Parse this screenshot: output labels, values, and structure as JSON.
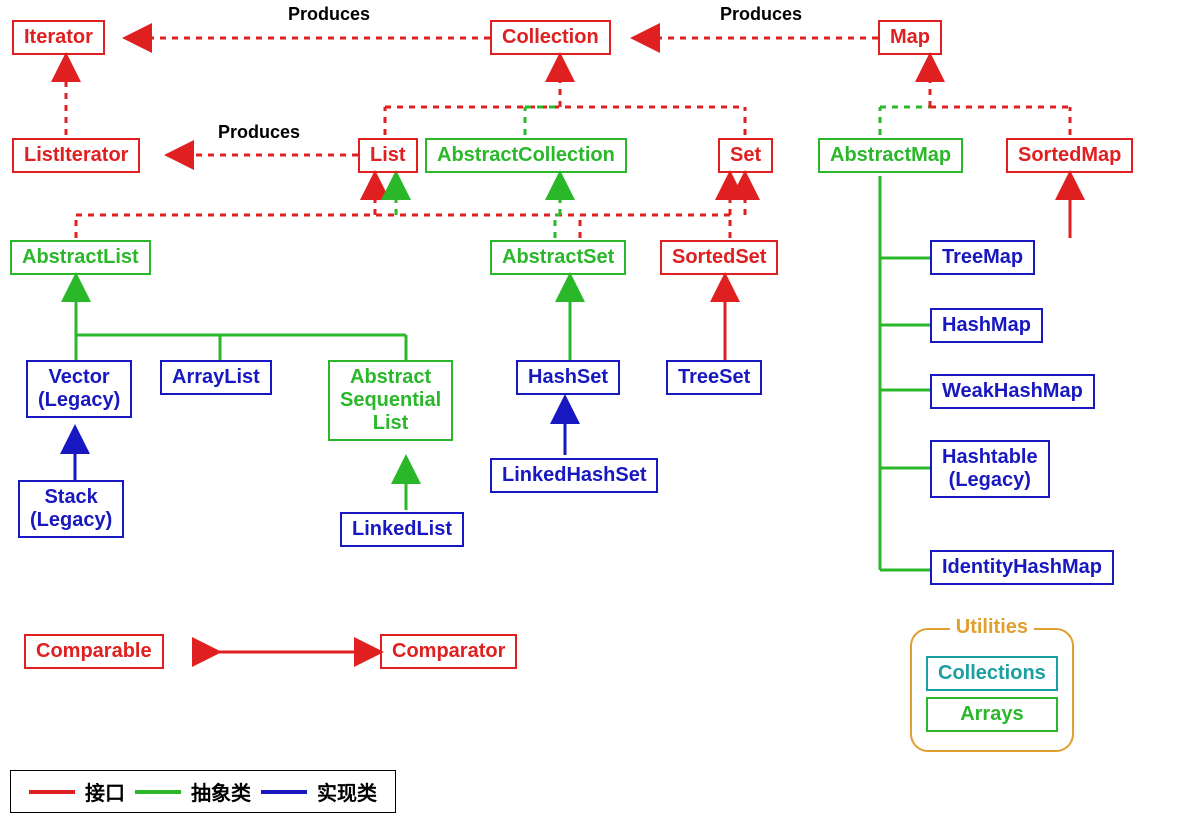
{
  "produces": "Produces",
  "nodes": {
    "iterator": "Iterator",
    "collection": "Collection",
    "map": "Map",
    "listiterator": "ListIterator",
    "list": "List",
    "abstractcollection": "AbstractCollection",
    "set": "Set",
    "abstractmap": "AbstractMap",
    "sortedmap": "SortedMap",
    "abstractlist": "AbstractList",
    "abstractset": "AbstractSet",
    "sortedset": "SortedSet",
    "vector": "Vector\n(Legacy)",
    "arraylist": "ArrayList",
    "abstractsequentiallist": "Abstract\nSequential\nList",
    "hashset": "HashSet",
    "treeset": "TreeSet",
    "linkedhashset": "LinkedHashSet",
    "stack": "Stack\n(Legacy)",
    "linkedlist": "LinkedList",
    "treemap": "TreeMap",
    "hashmap": "HashMap",
    "weakhashmap": "WeakHashMap",
    "hashtable": "Hashtable\n(Legacy)",
    "identityhashmap": "IdentityHashMap",
    "comparable": "Comparable",
    "comparator": "Comparator"
  },
  "utilities": {
    "title": "Utilities",
    "collections": "Collections",
    "arrays": "Arrays"
  },
  "legend": {
    "interface": "接口",
    "abstract": "抽象类",
    "impl": "实现类"
  }
}
